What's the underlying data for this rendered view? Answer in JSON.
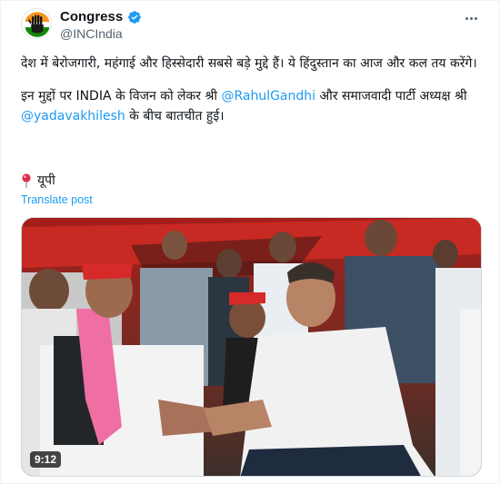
{
  "post": {
    "author": {
      "display_name": "Congress",
      "handle": "@INCIndia",
      "verified": true,
      "avatar_icon": "congress-hand-logo-icon"
    },
    "menu_icon": "more-options-icon",
    "text": {
      "line1": "देश में बेरोजगारी, महंगाई और हिस्सेदारी सबसे बड़े मुद्दे हैं। ये हिंदुस्तान का आज और कल तय करेंगे।",
      "line2_prefix": "इन मुद्दों पर INDIA के विजन को लेकर श्री ",
      "mention1": "@RahulGandhi",
      "line2_middle": " और समाजवादी पार्टी अध्यक्ष श्री ",
      "mention2": "@yadavakhilesh",
      "line2_suffix": " के बीच बातचीत हुई।"
    },
    "location": {
      "icon": "round-pushpin-icon",
      "label": "यूपी"
    },
    "translate_label": "Translate post",
    "media": {
      "type": "video",
      "duration": "9:12"
    }
  },
  "colors": {
    "link": "#1d9bf0",
    "secondary_text": "#536471",
    "verified_badge": "#1d9bf0"
  }
}
